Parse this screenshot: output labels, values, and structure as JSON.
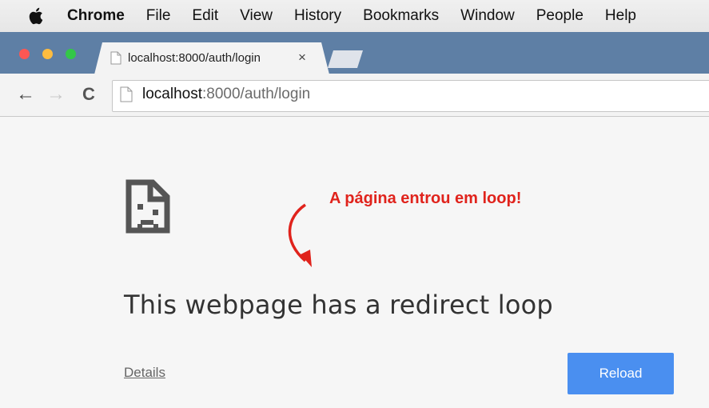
{
  "menubar": {
    "apple_icon": "apple-logo-icon",
    "app_name": "Chrome",
    "items": [
      "File",
      "Edit",
      "View",
      "History",
      "Bookmarks",
      "Window",
      "People",
      "Help"
    ]
  },
  "window_controls": {
    "close_color": "#fc5753",
    "minimize_color": "#fdbc40",
    "zoom_color": "#33c748"
  },
  "tab": {
    "title": "localhost:8000/auth/login",
    "close_label": "×",
    "favicon": "page-icon"
  },
  "toolbar": {
    "back_icon": "←",
    "forward_icon": "→",
    "reload_icon": "C",
    "url_host": "localhost",
    "url_path": ":8000/auth/login"
  },
  "content": {
    "icon": "sad-page-icon",
    "annotation": "A página entrou em loop!",
    "annotation_color": "#e0231c",
    "headline": "This webpage has a redirect loop",
    "details_label": "Details",
    "reload_label": "Reload",
    "reload_color": "#4a8ff0"
  }
}
